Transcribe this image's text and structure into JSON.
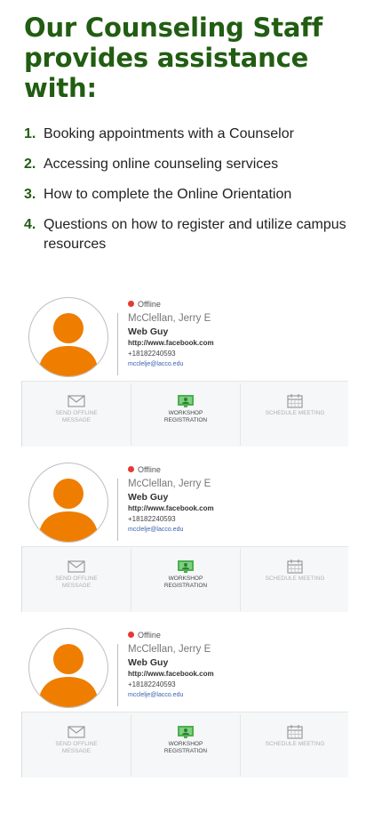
{
  "heading": "Our Counseling Staff provides assistance with:",
  "services": [
    {
      "num": "1.",
      "text": "Booking appointments with a Counselor"
    },
    {
      "num": "2.",
      "text": "Accessing online counseling services"
    },
    {
      "num": "3.",
      "text": "How to complete the Online Orientation"
    },
    {
      "num": "4.",
      "text": "Questions on how to register and utilize campus resources"
    }
  ],
  "cards": [
    {
      "status": "Offline",
      "name": "McClellan, Jerry E",
      "title": "Web Guy",
      "website": "http://www.facebook.com",
      "phone": "+18182240593",
      "email": "mcclelje@lacco.edu",
      "actions": {
        "message": "Send Offline Message",
        "workshop": "Workshop Registration",
        "schedule": "Schedule Meeting"
      }
    },
    {
      "status": "Offline",
      "name": "McClellan, Jerry E",
      "title": "Web Guy",
      "website": "http://www.facebook.com",
      "phone": "+18182240593",
      "email": "mcclelje@lacco.edu",
      "actions": {
        "message": "Send Offline Message",
        "workshop": "Workshop Registration",
        "schedule": "Schedule Meeting"
      }
    },
    {
      "status": "Offline",
      "name": "McClellan, Jerry E",
      "title": "Web Guy",
      "website": "http://www.facebook.com",
      "phone": "+18182240593",
      "email": "mcclelje@lacco.edu",
      "actions": {
        "message": "Send Offline Message",
        "workshop": "Workshop Registration",
        "schedule": "Schedule Meeting"
      }
    }
  ],
  "colors": {
    "heading": "#215d12",
    "avatar": "#ef7d00",
    "status_offline": "#e53935",
    "workshop_icon": "#4caf50"
  },
  "icons": {
    "avatar": "person-avatar-icon",
    "status": "status-dot-icon",
    "message": "envelope-icon",
    "workshop": "monitor-icon",
    "schedule": "calendar-icon"
  }
}
